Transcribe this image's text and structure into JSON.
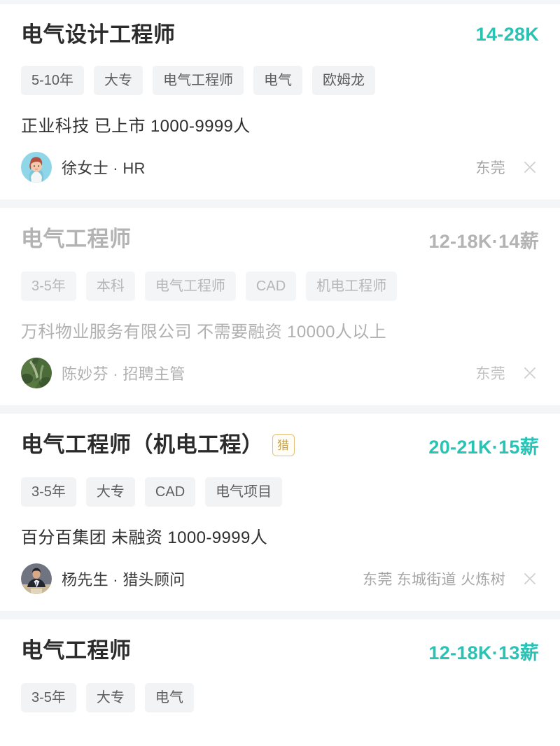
{
  "theme": {
    "accent_color": "#27c3b4",
    "page_background": "#ffffff",
    "separator_color": "#f4f5f6",
    "tag_background": "#f2f3f5",
    "muted_text_color": "#b3b3b3",
    "hunter_badge_color": "#c9a44c"
  },
  "jobs": [
    {
      "title": "电气设计工程师",
      "salary": "14-28K",
      "hunter_badge": "",
      "tags": [
        "5-10年",
        "大专",
        "电气工程师",
        "电气",
        "欧姆龙"
      ],
      "company": "正业科技 已上市 1000-9999人",
      "recruiter": "徐女士 · HR",
      "location": "东莞",
      "close_label": "×",
      "avatar": "cartoon-woman-avatar",
      "viewed": false
    },
    {
      "title": "电气工程师",
      "salary": "12-18K·14薪",
      "hunter_badge": "",
      "tags": [
        "3-5年",
        "本科",
        "电气工程师",
        "CAD",
        "机电工程师"
      ],
      "company": "万科物业服务有限公司 不需要融资 10000人以上",
      "recruiter": "陈妙芬 · 招聘主管",
      "location": "东莞",
      "close_label": "×",
      "avatar": "foliage-photo-avatar",
      "viewed": true
    },
    {
      "title": "电气工程师（机电工程）",
      "salary": "20-21K·15薪",
      "hunter_badge": "猎",
      "tags": [
        "3-5年",
        "大专",
        "CAD",
        "电气项目"
      ],
      "company": "百分百集团 未融资 1000-9999人",
      "recruiter": "杨先生 · 猎头顾问",
      "location": "东莞 东城街道 火炼树",
      "close_label": "×",
      "avatar": "businessman-photo-avatar",
      "viewed": false
    },
    {
      "title": "电气工程师",
      "salary": "12-18K·13薪",
      "hunter_badge": "",
      "tags": [
        "3-5年",
        "大专",
        "电气"
      ],
      "company": "",
      "recruiter": "",
      "location": "",
      "close_label": "",
      "avatar": "",
      "viewed": false
    }
  ]
}
